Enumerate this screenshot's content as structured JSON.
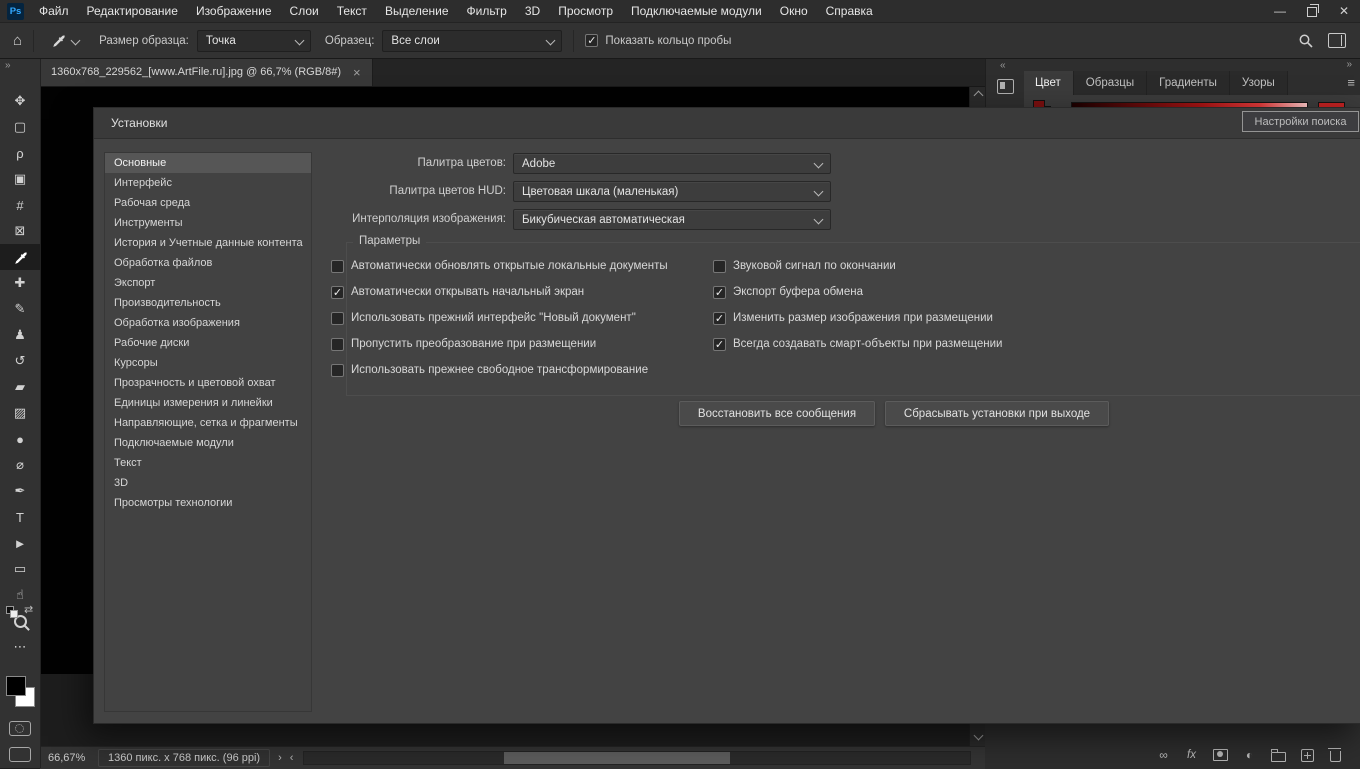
{
  "app": {
    "logo_text": "Ps"
  },
  "menubar": {
    "items": [
      "Файл",
      "Редактирование",
      "Изображение",
      "Слои",
      "Текст",
      "Выделение",
      "Фильтр",
      "3D",
      "Просмотр",
      "Подключаемые модули",
      "Окно",
      "Справка"
    ]
  },
  "window_controls": {
    "minimize": "—",
    "close": "✕"
  },
  "glyphs": {
    "home": "⌂",
    "toolbar_collapse": "»",
    "narrow_dock_collapse": "«",
    "dock_collapse": "»",
    "panel_menu": "≡",
    "status_menu_arrow": "›",
    "scroll_left_arrow": "‹",
    "tab_close": "×"
  },
  "options_bar": {
    "active_tool": "eyedropper",
    "sample_size_label": "Размер образца:",
    "sample_size_value": "Точка",
    "sample_label": "Образец:",
    "sample_value": "Все слои",
    "show_ring_label": "Показать кольцо пробы",
    "show_ring_checked": true
  },
  "document_tab": {
    "title": "1360x768_229562_[www.ArtFile.ru].jpg @ 66,7% (RGB/8#)"
  },
  "toolbar": {
    "tools": [
      {
        "name": "move-tool"
      },
      {
        "name": "rectangular-marquee-tool"
      },
      {
        "name": "lasso-tool"
      },
      {
        "name": "object-selection-tool"
      },
      {
        "name": "crop-tool"
      },
      {
        "name": "frame-tool"
      },
      {
        "name": "eyedropper-tool",
        "selected": true
      },
      {
        "name": "spot-healing-brush-tool"
      },
      {
        "name": "brush-tool"
      },
      {
        "name": "clone-stamp-tool"
      },
      {
        "name": "history-brush-tool"
      },
      {
        "name": "eraser-tool"
      },
      {
        "name": "gradient-tool"
      },
      {
        "name": "blur-tool"
      },
      {
        "name": "dodge-tool"
      },
      {
        "name": "pen-tool"
      },
      {
        "name": "type-tool"
      },
      {
        "name": "path-selection-tool"
      },
      {
        "name": "rectangle-tool"
      },
      {
        "name": "hand-tool"
      },
      {
        "name": "zoom-tool"
      },
      {
        "name": "edit-toolbar"
      }
    ]
  },
  "right_dock": {
    "tabs": [
      "Цвет",
      "Образцы",
      "Градиенты",
      "Узоры"
    ],
    "active_tab": "Цвет",
    "current_color": "#c22222",
    "search_tooltip": "Настройки поиска"
  },
  "panels_footer": {
    "icons": [
      "link-icon",
      "fx-icon",
      "layer-mask-icon",
      "adjustment-icon",
      "group-icon",
      "new-layer-icon",
      "delete-icon"
    ]
  },
  "dialog": {
    "title": "Установки",
    "categories": [
      "Основные",
      "Интерфейс",
      "Рабочая среда",
      "Инструменты",
      "История и Учетные данные контента",
      "Обработка файлов",
      "Экспорт",
      "Производительность",
      "Обработка изображения",
      "Рабочие диски",
      "Курсоры",
      "Прозрачность и цветовой охват",
      "Единицы измерения и линейки",
      "Направляющие, сетка и фрагменты",
      "Подключаемые модули",
      "Текст",
      "3D",
      "Просмотры технологии"
    ],
    "selected_category": "Основные",
    "fields": [
      {
        "label": "Палитра цветов:",
        "value": "Adobe"
      },
      {
        "label": "Палитра цветов HUD:",
        "value": "Цветовая шкала (маленькая)"
      },
      {
        "label": "Интерполяция изображения:",
        "value": "Бикубическая автоматическая"
      }
    ],
    "options_group": {
      "title": "Параметры",
      "left_options": [
        {
          "label": "Автоматически обновлять открытые локальные документы",
          "checked": false
        },
        {
          "label": "Автоматически открывать начальный экран",
          "checked": true
        },
        {
          "label": "Использовать прежний интерфейс \"Новый документ\"",
          "checked": false
        },
        {
          "label": "Пропустить преобразование при размещении",
          "checked": false
        },
        {
          "label": "Использовать прежнее свободное трансформирование",
          "checked": false
        }
      ],
      "right_options": [
        {
          "label": "Звуковой сигнал по окончании",
          "checked": false
        },
        {
          "label": "Экспорт буфера обмена",
          "checked": true
        },
        {
          "label": "Изменить размер изображения при размещении",
          "checked": true
        },
        {
          "label": "Всегда создавать смарт-объекты при размещении",
          "checked": true
        }
      ]
    },
    "buttons": [
      "Восстановить все сообщения",
      "Сбрасывать установки при выходе"
    ]
  },
  "status_bar": {
    "zoom": "66,67%",
    "doc_info": "1360 пикс. x 768 пикс. (96 ppi)"
  }
}
